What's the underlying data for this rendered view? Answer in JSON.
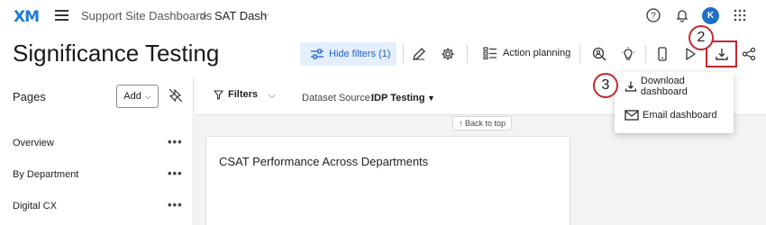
{
  "app": {
    "logo": "XM"
  },
  "breadcrumb": {
    "parent": "Support Site Dashboards",
    "separator": ">",
    "current": "SAT Dash"
  },
  "user": {
    "avatar_initial": "K"
  },
  "page": {
    "title": "Significance Testing"
  },
  "toolbar": {
    "hide_filters_label": "Hide filters (1)",
    "action_planning_label": "Action planning"
  },
  "annotations": {
    "step2": "2",
    "step3": "3"
  },
  "download_menu": {
    "items": [
      {
        "label": "Download dashboard"
      },
      {
        "label": "Email dashboard"
      }
    ]
  },
  "sidebar": {
    "title": "Pages",
    "add_label": "Add",
    "items": [
      {
        "label": "Overview"
      },
      {
        "label": "By Department"
      },
      {
        "label": "Digital CX"
      }
    ]
  },
  "filterbar": {
    "filters_label": "Filters",
    "dataset_label": "Dataset Source:",
    "dataset_value": "IDP Testing",
    "back_to_top": "↑ Back to top"
  },
  "widget": {
    "title": "CSAT Performance Across Departments"
  },
  "colors": {
    "accent_blue": "#1e63c6",
    "annotation_red": "#c2282f",
    "hide_filters_bg": "#e4eefc"
  }
}
